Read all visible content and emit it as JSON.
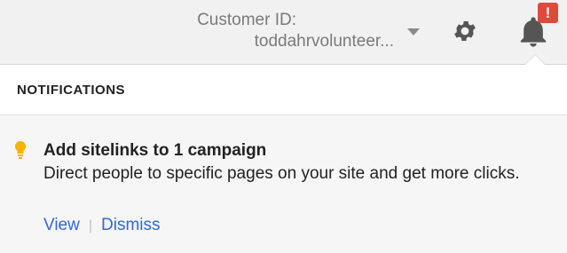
{
  "header": {
    "customer_label": "Customer ID:",
    "customer_value": "toddahrvolunteer...",
    "notification_count": "!"
  },
  "icons": {
    "dropdown": "chevron-down-icon",
    "settings": "gear-icon",
    "notifications": "bell-icon",
    "tip": "lightbulb-icon"
  },
  "colors": {
    "badge": "#dd4b39",
    "link": "#3367d6",
    "bulb": "#f4b400",
    "icon": "#555555"
  },
  "panel": {
    "title": "NOTIFICATIONS",
    "notifications": [
      {
        "title": "Add sitelinks to 1 campaign",
        "body": "Direct people to specific pages on your site and get more clicks.",
        "actions": {
          "view": "View",
          "separator": "|",
          "dismiss": "Dismiss"
        }
      }
    ]
  }
}
